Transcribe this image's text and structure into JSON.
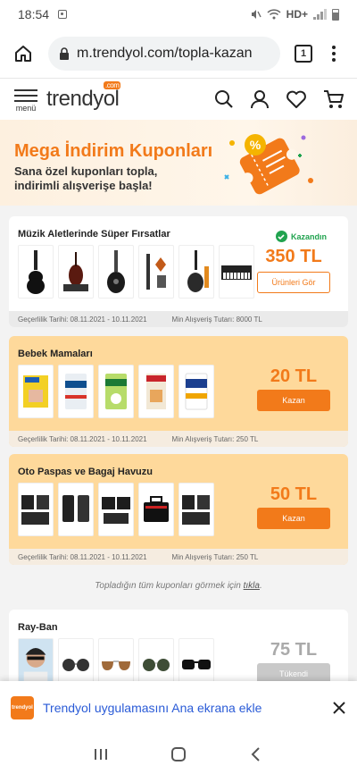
{
  "status": {
    "time": "18:54",
    "network": "HD+"
  },
  "browser": {
    "url": "m.trendyol.com/topla-kazan",
    "tab_count": "1"
  },
  "site": {
    "logo": "trendyol",
    "logo_suffix": ".com",
    "menu_label": "menü"
  },
  "hero": {
    "title": "Mega İndirim Kuponları",
    "subtitle_line1": "Sana özel kuponları topla,",
    "subtitle_line2": "indirimli alışverişe başla!"
  },
  "coupons": [
    {
      "title": "Müzik Aletlerinde Süper Fırsatlar",
      "status": "Kazandın",
      "amount": "350 TL",
      "button": "Ürünleri Gör",
      "validity": "Geçerlilik Tarihi: 08.11.2021 - 10.11.2021",
      "min_spend": "Min Alışveriş Tutarı: 8000 TL",
      "products": [
        "acoustic-guitar",
        "violin-set",
        "electric-guitar",
        "guitar-accessories",
        "guitar-kit",
        "keyboard"
      ]
    },
    {
      "title": "Bebek Mamaları",
      "amount": "20 TL",
      "button": "Kazan",
      "validity": "Geçerlilik Tarihi: 08.11.2021 - 10.11.2021",
      "min_spend": "Min Alışveriş Tutarı: 250 TL",
      "products": [
        "bebelac-box",
        "evolvia-can",
        "humana-can",
        "hipp-box",
        "sma-can"
      ]
    },
    {
      "title": "Oto Paspas ve Bagaj Havuzu",
      "amount": "50 TL",
      "button": "Kazan",
      "validity": "Geçerlilik Tarihi: 08.11.2021 - 10.11.2021",
      "min_spend": "Min Alışveriş Tutarı: 250 TL",
      "products": [
        "car-mat-set",
        "car-mat-pair",
        "car-mat-floor",
        "trunk-organizer",
        "car-mat-set-2"
      ]
    },
    {
      "title": "Ray-Ban",
      "amount": "75 TL",
      "button": "Tükendi",
      "products": [
        "model-portrait",
        "round-sunglasses",
        "aviator-sunglasses",
        "green-sunglasses",
        "wayfarer-sunglasses"
      ]
    }
  ],
  "note": {
    "text": "Topladığın tüm kuponları görmek için",
    "link": "tıkla",
    "end": "."
  },
  "install_banner": {
    "text": "Trendyol uygulamasını Ana ekrana ekle",
    "app_label": "trendyol"
  },
  "colors": {
    "brand": "#f27a1a",
    "success": "#21a34f",
    "highlight": "#fed99b"
  }
}
